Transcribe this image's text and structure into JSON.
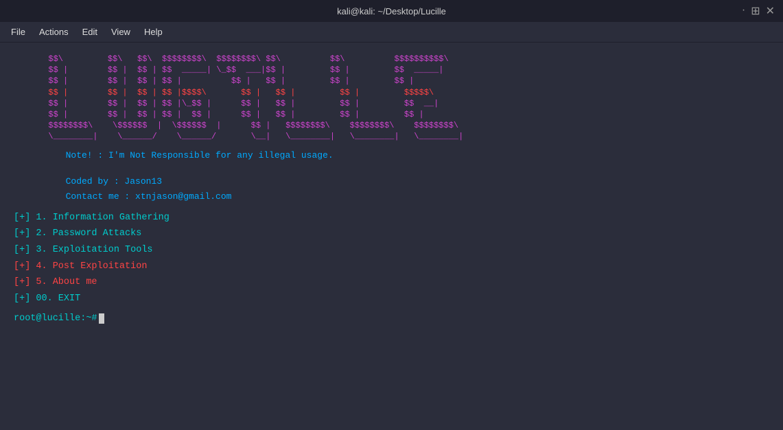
{
  "titlebar": {
    "title": "kali@kali: ~/Desktop/Lucille",
    "minimize": "—",
    "maximize": "⊞",
    "close": "✕"
  },
  "menubar": {
    "items": [
      "File",
      "Actions",
      "Edit",
      "View",
      "Help"
    ]
  },
  "terminal": {
    "note_line1": "Note! : I'm Not Responsible for any illegal usage.",
    "note_line2": "Coded by : Jason13",
    "note_line3": "Contact me : xtnjason@gmail.com",
    "menu_items": [
      {
        "prefix": "[+]",
        "text": "1. Information Gathering",
        "color": "cyan"
      },
      {
        "prefix": "[+]",
        "text": "2. Password Attacks",
        "color": "cyan"
      },
      {
        "prefix": "[+]",
        "text": "3. Exploitation Tools",
        "color": "cyan"
      },
      {
        "prefix": "[+]",
        "text": "4. Post Exploitation",
        "color": "red"
      },
      {
        "prefix": "[+]",
        "text": "5. About me",
        "color": "red"
      },
      {
        "prefix": "[+]",
        "text": "00. EXIT",
        "color": "cyan"
      }
    ],
    "prompt": "root@lucille:~# "
  }
}
